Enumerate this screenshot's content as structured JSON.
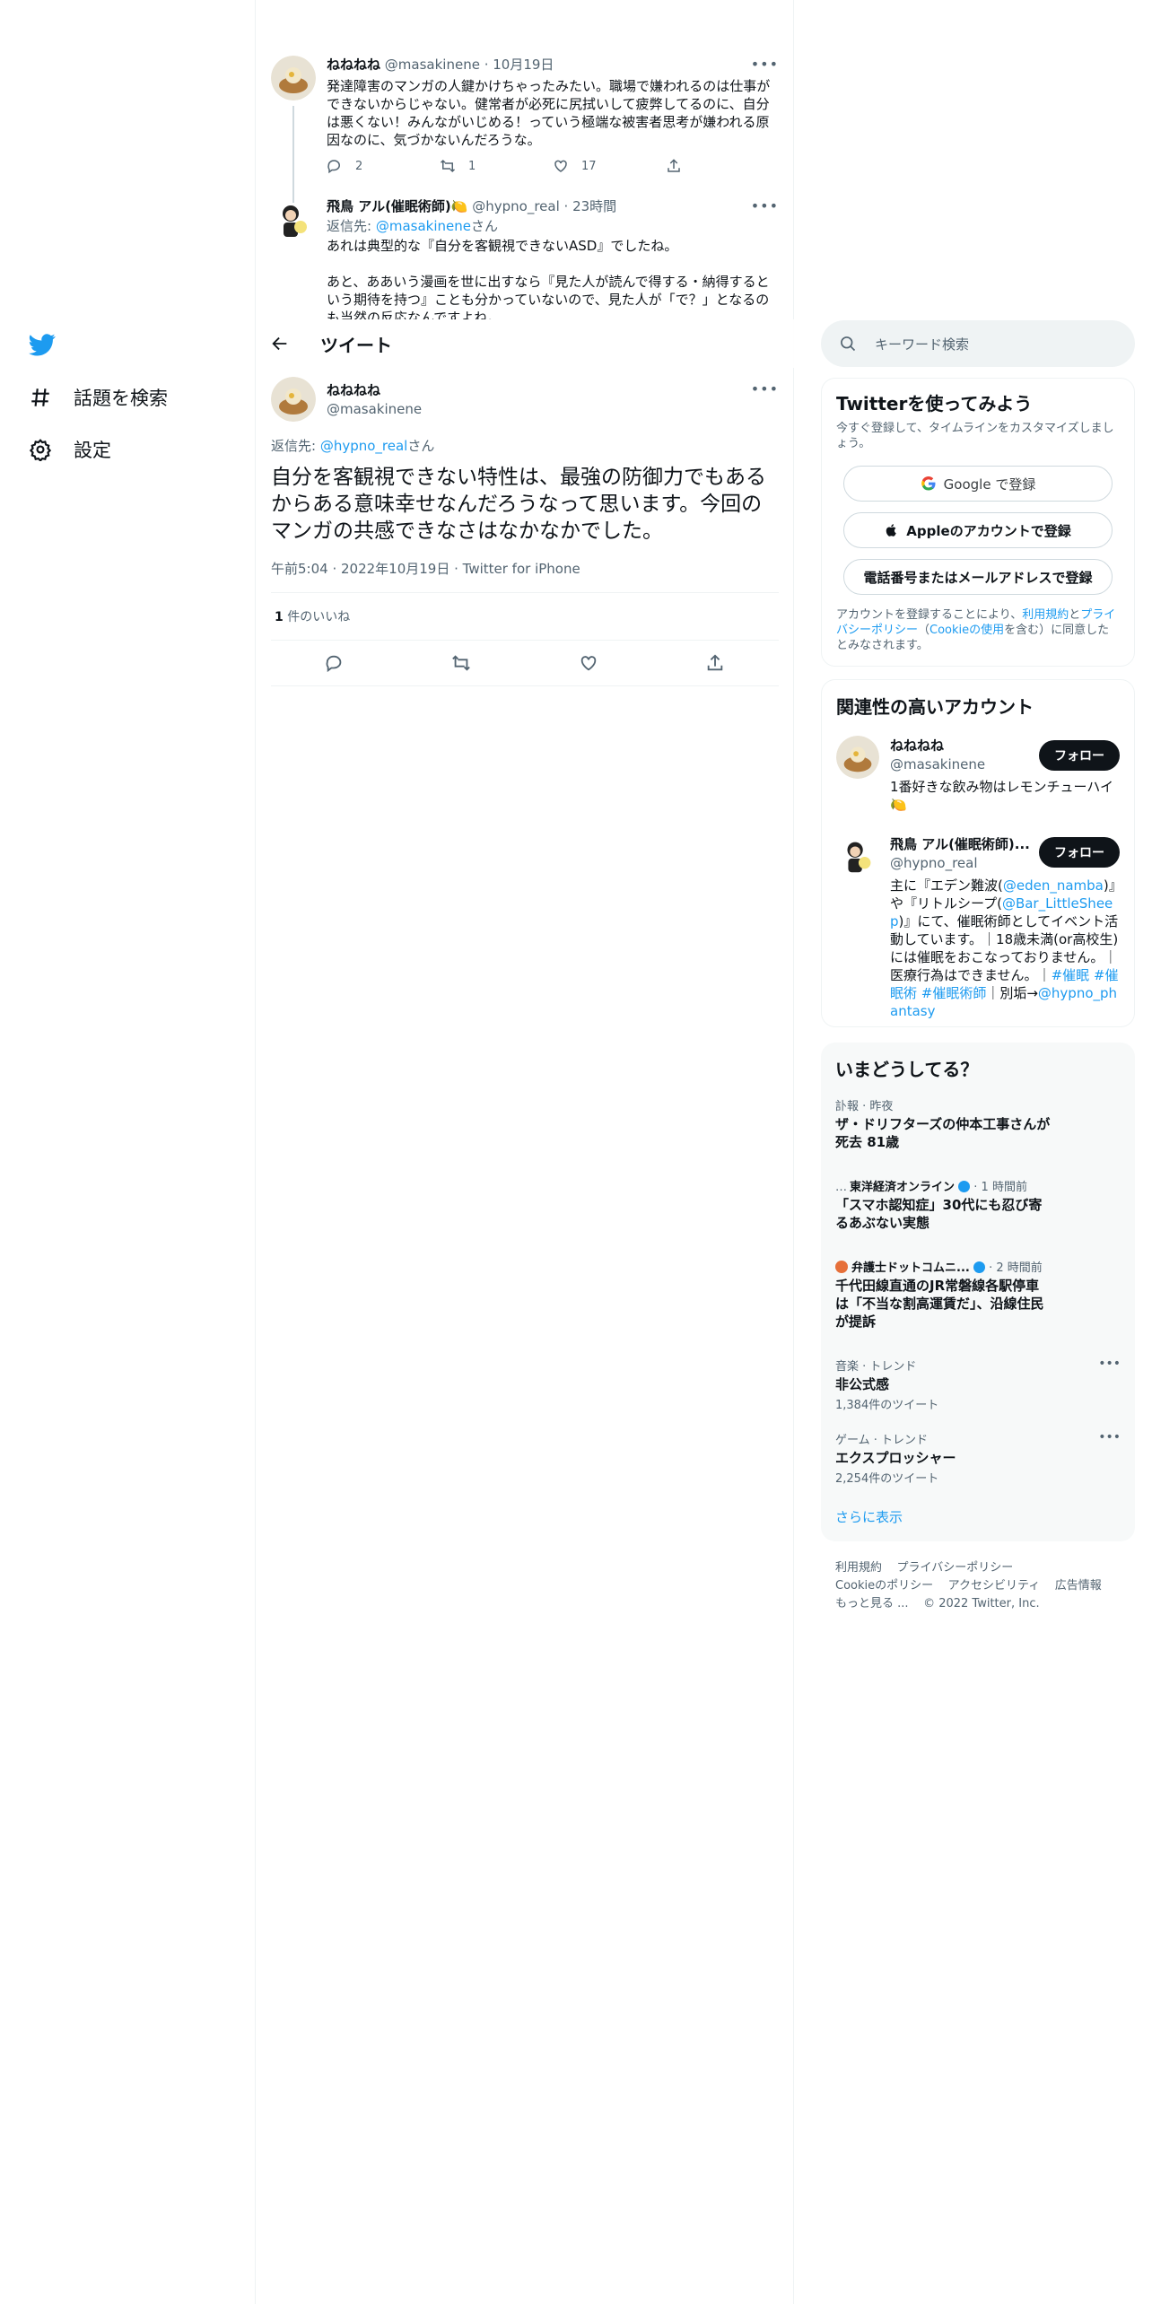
{
  "nav": {
    "items": [
      {
        "label": "話題を検索",
        "icon": "hashtag-icon"
      },
      {
        "label": "設定",
        "icon": "gear-icon"
      }
    ]
  },
  "thread": [
    {
      "name": "ねねねね",
      "handle": "@masakinene",
      "time": "· 10月19日",
      "text": "発達障害のマンガの人鍵かけちゃったみたい。職場で嫌われるのは仕事ができないからじゃない。健常者が必死に尻拭いして疲弊してるのに、自分は悪くない！みんながいじめる！っていう極端な被害者思考が嫌われる原因なのに、気づかないんだろうな。",
      "replies": "2",
      "retweets": "1",
      "likes": "17"
    },
    {
      "name": "飛鳥 アル(催眠術師)🍋",
      "handle": "@hypno_real",
      "time": "· 23時間",
      "reply_prefix": "返信先: ",
      "reply_to": "@masakinene",
      "reply_suffix": "さん",
      "text": "あれは典型的な『自分を客観視できないASD』でしたね。\n\nあと、ああいう漫画を世に出すなら『見た人が読んで得する・納得すると いう期待を持つ』ことも分かっていないので、見た人が「で？」となるのも当然の反応なんですよね。"
    }
  ],
  "header": {
    "title": "ツイート"
  },
  "focus": {
    "name": "ねねねね",
    "handle": "@masakinene",
    "reply_prefix": "返信先: ",
    "reply_to": "@hypno_real",
    "reply_suffix": "さん",
    "text": "自分を客観視できない特性は、最強の防御力でもあるからある意味幸せなんだろうなって思います。今回のマンガの共感できなさはなかなかでした。",
    "meta": "午前5:04 · 2022年10月19日 · Twitter for iPhone",
    "like_count": "1",
    "like_label": " 件のいいね"
  },
  "search": {
    "placeholder": "キーワード検索"
  },
  "signup": {
    "title": "Twitterを使ってみよう",
    "subtitle": "今すぐ登録して、タイムラインをカスタマイズしましょう。",
    "google": "Google で登録",
    "apple": "Appleのアカウントで登録",
    "phone": "電話番号またはメールアドレスで登録",
    "legal_1": "アカウントを登録することにより、",
    "legal_terms": "利用規約",
    "legal_2": "と",
    "legal_privacy": "プライバシーポリシー",
    "legal_3": "（",
    "legal_cookie": "Cookieの使用",
    "legal_4": "を含む）に同意したとみなされます。"
  },
  "accounts": {
    "title": "関連性の高いアカウント",
    "follow_label": "フォロー",
    "items": [
      {
        "name": "ねねねね",
        "handle": "@masakinene",
        "bio": "1番好きな飲み物はレモンチューハイ🍋"
      },
      {
        "name": "飛鳥 アル(催眠術師)...",
        "handle": "@hypno_real",
        "bio_1": "主に『エデン難波(",
        "bio_link1": "@eden_namba",
        "bio_2": ")』や『リトルシープ(",
        "bio_link2": "@Bar_LittleSheep",
        "bio_3": ")』にて、催眠術師としてイベント活動しています。｜18歳未満(or高校生)には催眠をおこなっておりません。｜医療行為はできません。｜",
        "bio_tags": "#催眠 #催眠術 #催眠術師",
        "bio_4": "｜別垢→",
        "bio_link3": "@hypno_phantasy"
      }
    ]
  },
  "trends": {
    "title": "いまどうしてる？",
    "items": [
      {
        "context": "訃報 · 昨夜",
        "name": "ザ・ドリフターズの仲本工事さんが死去 81歳"
      },
      {
        "context": "東洋経済オンライン",
        "context_time": " · 1 時間前",
        "name": "「スマホ認知症」30代にも忍び寄るあぶない実態"
      },
      {
        "context": "弁護士ドットコムニ...",
        "context_time": " · 2 時間前",
        "name": "千代田線直通のJR常磐線各駅停車は「不当な割高運賃だ」、沿線住民が提訴"
      },
      {
        "context": "音楽 · トレンド",
        "name": "非公式感",
        "count": "1,384件のツイート"
      },
      {
        "context": "ゲーム · トレンド",
        "name": "エクスプロッシャー",
        "count": "2,254件のツイート"
      }
    ],
    "show_more": "さらに表示"
  },
  "footer": {
    "links": [
      "利用規約",
      "プライバシーポリシー",
      "Cookieのポリシー",
      "アクセシビリティ",
      "広告情報",
      "もっと見る ..."
    ],
    "copyright": "© 2022 Twitter, Inc."
  },
  "colors": {
    "accent": "#1d9bf0",
    "text": "#0f1419",
    "secondary": "#536471"
  }
}
